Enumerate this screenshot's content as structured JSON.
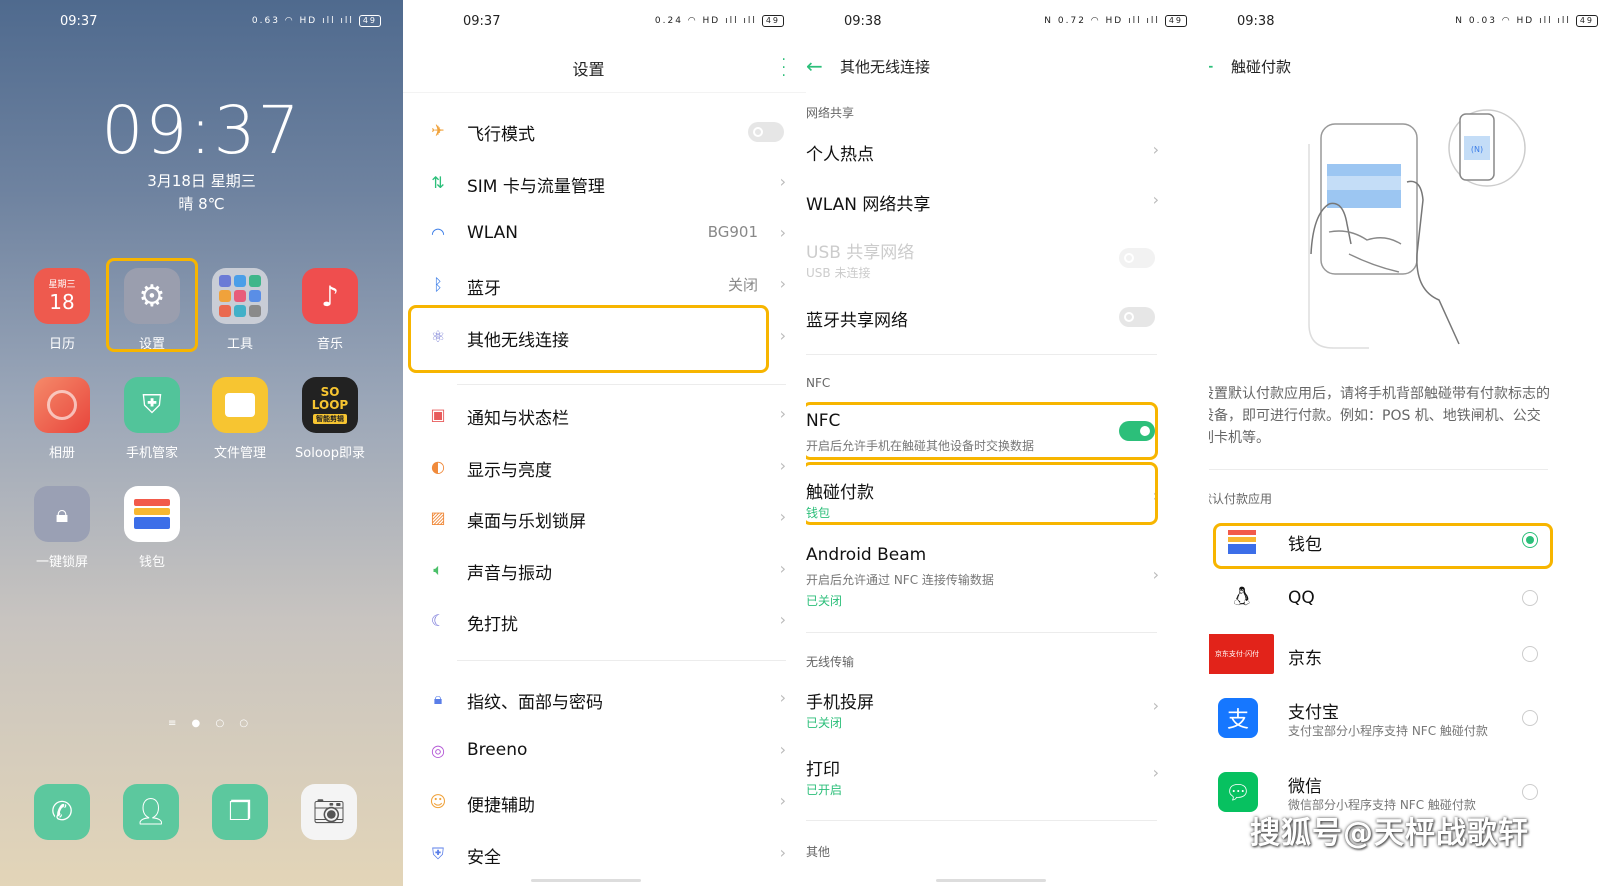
{
  "home": {
    "status_time": "09:37",
    "status_icons": "0.63 ◠ HD ıll ıll",
    "battery": "49",
    "clock": "09:37",
    "date": "3月18日 星期三",
    "weather": "晴 8℃",
    "calendar_top": "星期三",
    "calendar_day": "18",
    "apps": [
      "日历",
      "设置",
      "工具",
      "音乐",
      "相册",
      "手机管家",
      "文件管理",
      "Soloop即录",
      "一键锁屏",
      "钱包"
    ],
    "soloop_text": "SO LOOP",
    "soloop_sub": "智能剪辑",
    "page_dots": "≡ ● ○ ○"
  },
  "settings": {
    "status_time": "09:37",
    "status_icons": "0.24 ◠ HD ıll ıll",
    "battery": "49",
    "title": "设置",
    "items": [
      {
        "label": "飞行模式"
      },
      {
        "label": "SIM 卡与流量管理"
      },
      {
        "label": "WLAN",
        "value": "BG901"
      },
      {
        "label": "蓝牙",
        "value": "关闭"
      },
      {
        "label": "其他无线连接"
      },
      {
        "label": "通知与状态栏"
      },
      {
        "label": "显示与亮度"
      },
      {
        "label": "桌面与乐划锁屏"
      },
      {
        "label": "声音与振动"
      },
      {
        "label": "免打扰"
      },
      {
        "label": "指纹、面部与密码"
      },
      {
        "label": "Breeno"
      },
      {
        "label": "便捷辅助"
      },
      {
        "label": "安全"
      }
    ]
  },
  "wireless": {
    "status_time": "09:38",
    "status_icons": "N 0.72 ◠ HD ıll ıll",
    "battery": "49",
    "title": "其他无线连接",
    "sec_share": "网络共享",
    "hotspot": "个人热点",
    "wlan_share": "WLAN 网络共享",
    "usb_share": "USB 共享网络",
    "usb_sub": "USB 未连接",
    "bt_share": "蓝牙共享网络",
    "sec_nfc": "NFC",
    "nfc": "NFC",
    "nfc_sub": "开启后允许手机在触碰其他设备时交换数据",
    "tap_pay": "触碰付款",
    "tap_pay_sub": "钱包",
    "beam": "Android Beam",
    "beam_sub": "开启后允许通过 NFC 连接传输数据",
    "beam_state": "已关闭",
    "sec_wireless": "无线传输",
    "cast": "手机投屏",
    "cast_state": "已关闭",
    "print": "打印",
    "print_state": "已开启",
    "sec_other": "其他"
  },
  "tap_pay": {
    "status_time": "09:38",
    "status_icons": "N 0.03 ◠ HD ıll ıll",
    "battery": "49",
    "title": "触碰付款",
    "nfc_badge": "(N)",
    "desc": "设置默认付款应用后，请将手机背部触碰带有付款标志的设备，即可进行付款。例如：POS 机、地铁闸机、公交刷卡机等。",
    "sec_default": "默认付款应用",
    "apps": [
      {
        "name": "钱包",
        "sub": "",
        "selected": true
      },
      {
        "name": "QQ",
        "sub": "",
        "selected": false
      },
      {
        "name": "京东",
        "sub": "",
        "selected": false
      },
      {
        "name": "支付宝",
        "sub": "支付宝部分小程序支持 NFC 触碰付款",
        "selected": false
      },
      {
        "name": "微信",
        "sub": "微信部分小程序支持 NFC 触碰付款",
        "selected": false
      }
    ],
    "jd_badge": "京东支付·闪付"
  },
  "watermark": "搜狐号@天枰战歌轩",
  "colors": {
    "accent": "#2cbf7a",
    "highlight": "#f7b500"
  }
}
